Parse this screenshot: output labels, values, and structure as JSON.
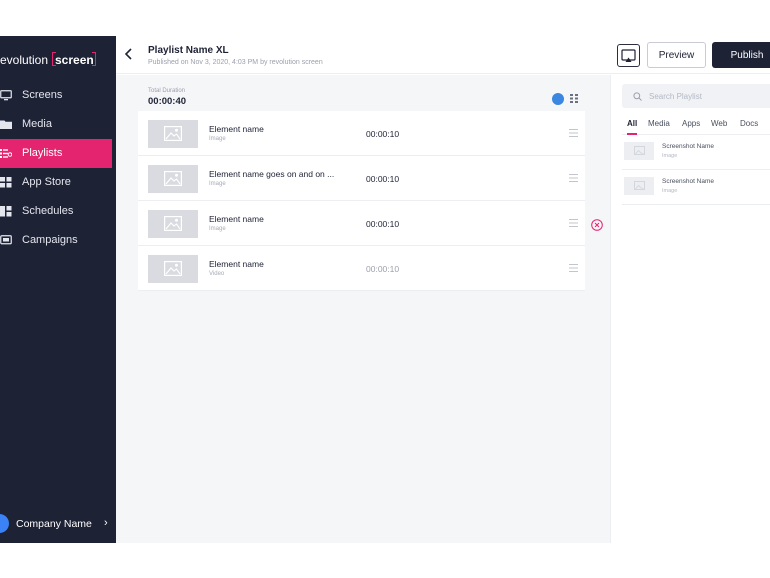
{
  "brand": {
    "word1": "revolution",
    "word2": "screen"
  },
  "sidebar": {
    "items": [
      {
        "label": "Screens",
        "icon": "monitor-icon",
        "active": false
      },
      {
        "label": "Media",
        "icon": "folder-icon",
        "active": false
      },
      {
        "label": "Playlists",
        "icon": "playlist-icon",
        "active": true
      },
      {
        "label": "App Store",
        "icon": "grid-icon",
        "active": false
      },
      {
        "label": "Schedules",
        "icon": "schedule-icon",
        "active": false
      },
      {
        "label": "Campaigns",
        "icon": "campaign-icon",
        "active": false
      }
    ],
    "company": "Company Name"
  },
  "header": {
    "title": "Playlist Name XL",
    "subtitle": "Published on Nov 3, 2020, 4:03 PM by revolution screen",
    "preview_label": "Preview",
    "publish_label": "Publish"
  },
  "playlist": {
    "duration_label": "Total Duration",
    "duration_value": "00:00:40",
    "elements": [
      {
        "name": "Element name",
        "type": "Image",
        "time": "00:00:10",
        "muted": false
      },
      {
        "name": "Element name goes on and on ...",
        "type": "Image",
        "time": "00:00:10",
        "muted": false
      },
      {
        "name": "Element name",
        "type": "Image",
        "time": "00:00:10",
        "muted": false
      },
      {
        "name": "Element name",
        "type": "Video",
        "time": "00:00:10",
        "muted": true
      }
    ]
  },
  "library": {
    "search_placeholder": "Search Playlist",
    "tabs": [
      "All",
      "Media",
      "Apps",
      "Web",
      "Docs"
    ],
    "active_tab": 0,
    "items": [
      {
        "name": "Screenshot Name",
        "type": "Image"
      },
      {
        "name": "Screenshot Name",
        "type": "Image"
      }
    ]
  },
  "colors": {
    "sidebar_bg": "#1e2235",
    "accent": "#e5246f",
    "toggle_blue": "#3b86e0",
    "avatar_blue": "#3b82f6"
  }
}
